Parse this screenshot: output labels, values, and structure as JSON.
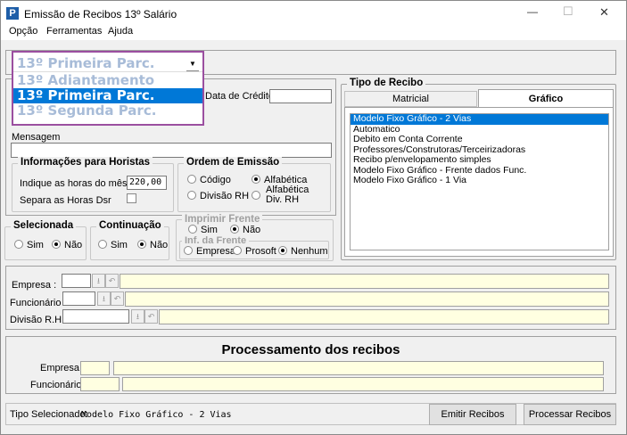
{
  "window": {
    "title": "Emissão de Recibos 13º Salário",
    "minimize": "—",
    "maximize": "☐",
    "close": "✕"
  },
  "menu": [
    "Opção",
    "Ferramentas",
    "Ajuda"
  ],
  "combo": {
    "selected": "13º Primeira Parc.",
    "options": [
      "13º Adiantamento",
      "13º Primeira Parc.",
      "13º Segunda Parc."
    ],
    "highlighted_index": 1
  },
  "data_credito": {
    "label": "Data de Crédito",
    "value": ""
  },
  "mensagem": {
    "label": "Mensagem",
    "value": ""
  },
  "horistas": {
    "title": "Informações para Horistas",
    "horas_label": "Indique as horas do mês",
    "horas_value": "220,00",
    "dsr_label": "Separa as Horas Dsr",
    "dsr_checked": false
  },
  "ordem": {
    "title": "Ordem de Emissão",
    "options": [
      "Código",
      "Alfabética",
      "Divisão RH",
      "Alfabética Div. RH"
    ],
    "selected": "Alfabética"
  },
  "tipo_recibo": {
    "title": "Tipo de Recibo",
    "tabs": [
      "Matricial",
      "Gráfico"
    ],
    "active_tab": "Gráfico",
    "items": [
      "Modelo Fixo Gráfico - 2 Vias",
      "Automatico",
      "Debito em Conta Corrente",
      "Professores/Construtoras/Terceirizadoras",
      "Recibo p/envelopamento simples",
      "Modelo Fixo Gráfico - Frente dados Func.",
      "Modelo Fixo Gráfico - 1 Via"
    ],
    "selected_index": 0
  },
  "selecionada": {
    "title": "Selecionada",
    "sim": "Sim",
    "nao": "Não",
    "selected": "Não"
  },
  "continuacao": {
    "title": "Continuação",
    "sim": "Sim",
    "nao": "Não",
    "selected": "Não"
  },
  "imprimir_frente": {
    "title": "Imprimir Frente",
    "sim": "Sim",
    "nao": "Não",
    "selected": "Não",
    "inf_title": "Inf. da Frente",
    "inf_options": [
      "Empresa",
      "Prosoft",
      "Nenhum"
    ],
    "inf_selected": "Nenhum"
  },
  "filtros": {
    "empresa": "Empresa :",
    "funcionario": "Funcionário :",
    "divisao": "Divisão R.H.:"
  },
  "processamento": {
    "title": "Processamento dos recibos",
    "empresa": "Empresa:",
    "funcionario": "Funcionário:"
  },
  "status": {
    "label": "Tipo Selecionado:",
    "value": "Modelo Fixo Gráfico - 2 Vias"
  },
  "buttons": {
    "emitir": "Emitir Recibos",
    "processar": "Processar Recibos"
  },
  "colors": {
    "highlight": "#0078d7",
    "combo_border": "#9b4fa0",
    "field_yellow": "#ffffe1"
  }
}
